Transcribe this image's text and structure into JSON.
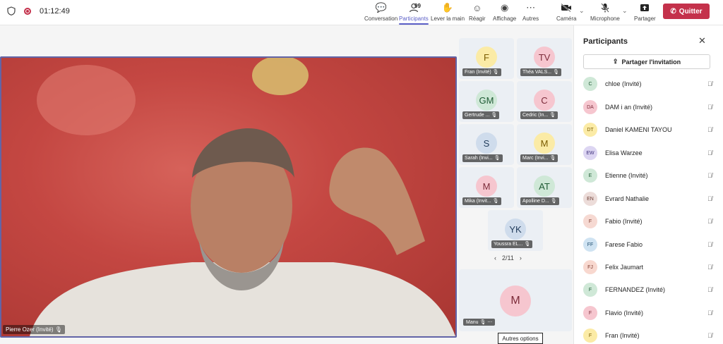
{
  "top_bar": {
    "timer": "01:12:49",
    "tools": [
      {
        "label": "Conversation",
        "icon": "chat-icon"
      },
      {
        "label": "Participants",
        "icon": "people-icon",
        "count": "99",
        "active": true
      },
      {
        "label": "Lever la main",
        "icon": "hand-icon"
      },
      {
        "label": "Réagir",
        "icon": "react-icon"
      },
      {
        "label": "Affichage",
        "icon": "view-icon"
      },
      {
        "label": "Autres",
        "icon": "more-icon"
      },
      {
        "label": "Caméra",
        "icon": "camera-off-icon"
      },
      {
        "label": "Microphone",
        "icon": "mic-off-icon"
      },
      {
        "label": "Partager",
        "icon": "share-icon"
      }
    ],
    "leave_label": "Quitter"
  },
  "stage": {
    "main_speaker": "Pierre Ozer (Invité)",
    "tiles": [
      {
        "initials": "F",
        "name": "Fran (Invité)",
        "bg": "#fbeba6",
        "fg": "#7a5b00"
      },
      {
        "initials": "TV",
        "name": "Théa VALS...",
        "bg": "#f6c6cf",
        "fg": "#7c2c3a"
      },
      {
        "initials": "GM",
        "name": "Gertrude ...",
        "bg": "#cfe8d7",
        "fg": "#1f5b34"
      },
      {
        "initials": "C",
        "name": "Cedric (In...",
        "bg": "#f6c6cf",
        "fg": "#7c2c3a"
      },
      {
        "initials": "S",
        "name": "Sarah (Invi...",
        "bg": "#cfdcec",
        "fg": "#223d5c"
      },
      {
        "initials": "M",
        "name": "Marc (Invi...",
        "bg": "#fbeba6",
        "fg": "#7a5b00"
      },
      {
        "initials": "M",
        "name": "Mika (Invit...",
        "bg": "#f6c6cf",
        "fg": "#7c2c3a"
      },
      {
        "initials": "AT",
        "name": "Apolline D...",
        "bg": "#cfe8d7",
        "fg": "#1f5b34"
      },
      {
        "initials": "YK",
        "name": "Youssra EL...",
        "bg": "#cfdcec",
        "fg": "#223d5c"
      }
    ],
    "pager": "2/11",
    "featured": {
      "initials": "M",
      "name": "Manu"
    },
    "tooltip": "Autres options"
  },
  "panel": {
    "title": "Participants",
    "invite_label": "Partager l'invitation",
    "participants": [
      {
        "initials": "C",
        "name": "chloe (Invité)",
        "bg": "#cfe8d7",
        "fg": "#1f5b34"
      },
      {
        "initials": "DA",
        "name": "DAM i an (Invité)",
        "bg": "#f6c6cf",
        "fg": "#7c2c3a"
      },
      {
        "initials": "DT",
        "name": "Daniel KAMENI TAYOU",
        "bg": "#fbeba6",
        "fg": "#7a5b00"
      },
      {
        "initials": "EW",
        "name": "Elisa Warzee",
        "bg": "#dcd5f2",
        "fg": "#3d2f7a"
      },
      {
        "initials": "E",
        "name": "Etienne (Invité)",
        "bg": "#cfe8d7",
        "fg": "#1f5b34"
      },
      {
        "initials": "EN",
        "name": "Evrard Nathalie",
        "bg": "#ecdcd9",
        "fg": "#6b3b33"
      },
      {
        "initials": "F",
        "name": "Fabio (Invité)",
        "bg": "#f6d9d2",
        "fg": "#7c3a2c"
      },
      {
        "initials": "FF",
        "name": "Farese Fabio",
        "bg": "#cfe3f2",
        "fg": "#1f4d6f"
      },
      {
        "initials": "FJ",
        "name": "Felix Jaumart",
        "bg": "#f8d8cf",
        "fg": "#7c3a2c"
      },
      {
        "initials": "F",
        "name": "FERNANDEZ (Invité)",
        "bg": "#cfe8d7",
        "fg": "#1f5b34"
      },
      {
        "initials": "F",
        "name": "Flavio (Invité)",
        "bg": "#f6c6cf",
        "fg": "#7c2c3a"
      },
      {
        "initials": "F",
        "name": "Fran (Invité)",
        "bg": "#fbeba6",
        "fg": "#7a5b00"
      }
    ]
  }
}
